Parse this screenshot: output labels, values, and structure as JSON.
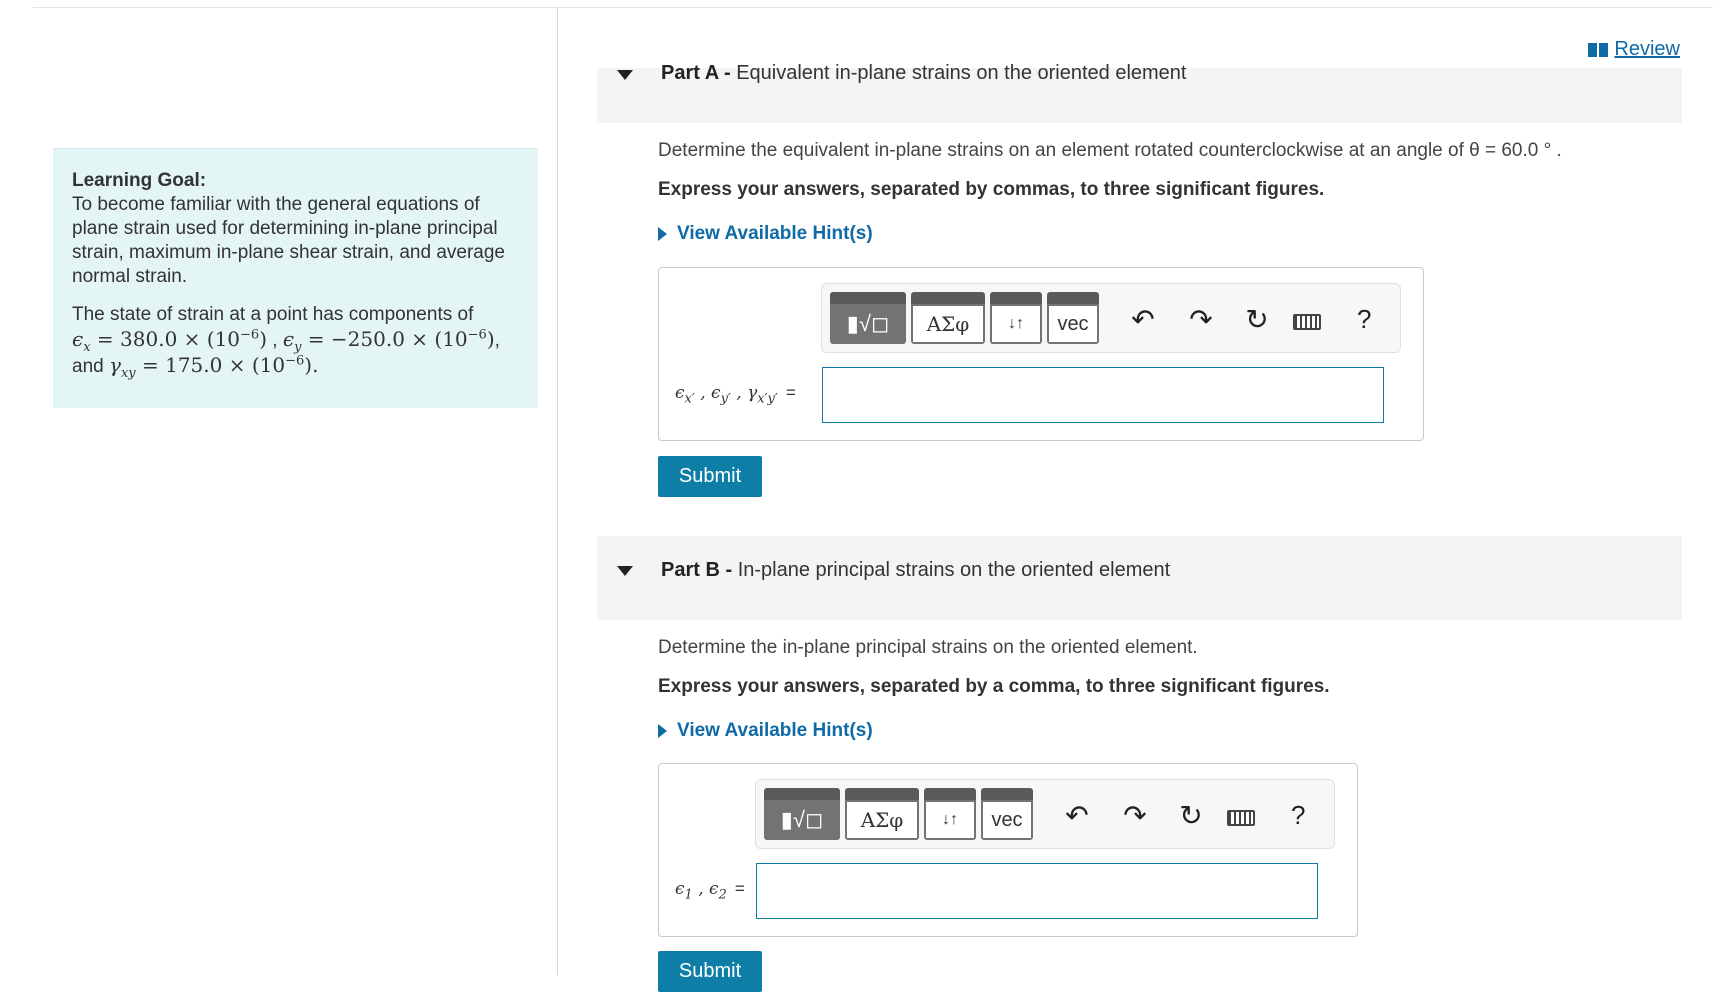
{
  "review_link": "Review",
  "learning_goal": {
    "heading": "Learning Goal:",
    "text": "To become familiar with the general equations of plane strain used for determining in-plane principal strain, maximum in-plane shear strain, and average normal strain.",
    "state_intro": "The state of strain at a point has components of",
    "ex_value": "380.0",
    "ey_value": "−250.0",
    "and_word": "and",
    "gxy_value": "175.0"
  },
  "part_a": {
    "label": "Part A -",
    "title": "Equivalent in-plane strains on the oriented element",
    "question": "Determine the equivalent in-plane strains on an element rotated counterclockwise at an angle of θ = 60.0 ° .",
    "instruction": "Express your answers, separated by commas, to three significant figures.",
    "hint": "View Available Hint(s)",
    "submit": "Submit"
  },
  "part_b": {
    "label": "Part B -",
    "title": "In-plane principal strains on the oriented element",
    "question": "Determine the in-plane principal strains on the oriented element.",
    "instruction": "Express your answers, separated by a comma, to three significant figures.",
    "hint": "View Available Hint(s)",
    "submit": "Submit"
  },
  "toolbar": {
    "greek": "ΑΣφ",
    "arrows": "↓↑",
    "vec": "vec",
    "help": "?"
  }
}
